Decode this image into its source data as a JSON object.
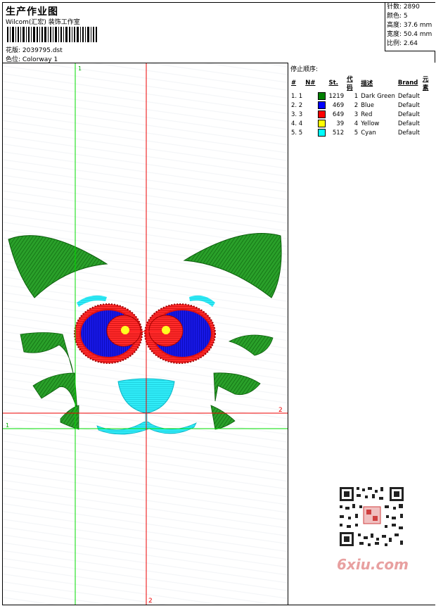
{
  "header": {
    "title": "生产作业图",
    "company": "Wilcom(汇宏) 装饰工作室",
    "design_label": "花版: 2039795.dst",
    "colorway_label": "色位: Colorway 1"
  },
  "stats": {
    "stitches": "针数: 2890",
    "colors": "颜色: 5",
    "height": "高度: 37.6 mm",
    "width": "宽度: 50.4 mm",
    "ratio": "比例: 2.64"
  },
  "stop_sequence": {
    "title": "停止顺序:",
    "headers": [
      "#",
      "N#",
      "St.",
      "代码",
      "描述",
      "Brand",
      "元素"
    ],
    "rows": [
      {
        "idx": "1. 1",
        "color": "#008000",
        "st": "1219",
        "code": "1",
        "desc": "Dark Green",
        "brand": "Default"
      },
      {
        "idx": "2. 2",
        "color": "#0000ff",
        "st": "469",
        "code": "2",
        "desc": "Blue",
        "brand": "Default"
      },
      {
        "idx": "3. 3",
        "color": "#ff0000",
        "st": "649",
        "code": "3",
        "desc": "Red",
        "brand": "Default"
      },
      {
        "idx": "4. 4",
        "color": "#ffff00",
        "st": "39",
        "code": "4",
        "desc": "Yellow",
        "brand": "Default"
      },
      {
        "idx": "5. 5",
        "color": "#00ffff",
        "st": "512",
        "code": "5",
        "desc": "Cyan",
        "brand": "Default"
      }
    ]
  },
  "guides": {
    "green_top": "1",
    "green_left": "1",
    "red_right": "2",
    "red_bottom": "2"
  },
  "colors": {
    "green": "#1e8c1e",
    "blue": "#1010e0",
    "red": "#e01010",
    "yellow": "#ffff20",
    "cyan": "#20e0f0",
    "guide_green": "#00dd00",
    "guide_red": "#ee0000"
  },
  "watermark": "6xiu.com"
}
